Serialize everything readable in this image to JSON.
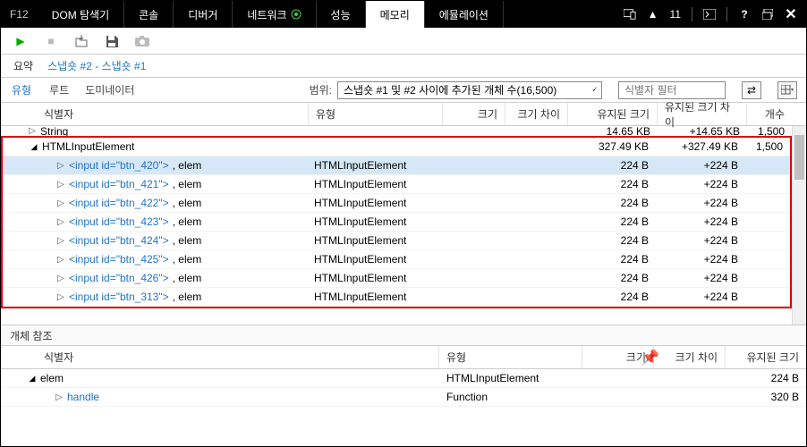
{
  "titlebar": {
    "f12": "F12",
    "tabs": [
      "DOM 탐색기",
      "콘솔",
      "디버거",
      "네트워크",
      "성능",
      "메모리",
      "에뮬레이션"
    ],
    "activeTab": 5,
    "errorCount": "11"
  },
  "subbar": {
    "summary": "요약",
    "link": "스냅숏 #2 - 스냅숏 #1"
  },
  "subbar2": {
    "tabs": [
      "유형",
      "루트",
      "도미네이터"
    ],
    "scopeLabel": "범위:",
    "scopeValue": "스냅숏 #1 및 #2 사이에 추가된 개체 수(16,500)",
    "filterPlaceholder": "식별자 필터"
  },
  "grid": {
    "columns": [
      "식별자",
      "유형",
      "크기",
      "크기 차이",
      "유지된 크기",
      "유지된 크기 차이",
      "개수"
    ],
    "rows": [
      {
        "level": 0,
        "expand": "right",
        "id": "String",
        "type": "",
        "size": "",
        "sdiff": "",
        "ret": "14.65 KB",
        "rdiff": "+14.65 KB",
        "cnt": "1,500",
        "cut": true
      },
      {
        "level": 0,
        "expand": "open",
        "id": "HTMLInputElement",
        "type": "",
        "size": "",
        "sdiff": "",
        "ret": "327.49 KB",
        "rdiff": "+327.49 KB",
        "cnt": "1,500",
        "boxstart": true
      },
      {
        "level": 1,
        "expand": "right",
        "id": "<input id=\"btn_420\">, elem",
        "type": "HTMLInputElement",
        "size": "",
        "sdiff": "",
        "ret": "224 B",
        "rdiff": "+224 B",
        "cnt": "",
        "selected": true,
        "link": true
      },
      {
        "level": 1,
        "expand": "right",
        "id": "<input id=\"btn_421\">, elem",
        "type": "HTMLInputElement",
        "size": "",
        "sdiff": "",
        "ret": "224 B",
        "rdiff": "+224 B",
        "cnt": "",
        "link": true
      },
      {
        "level": 1,
        "expand": "right",
        "id": "<input id=\"btn_422\">, elem",
        "type": "HTMLInputElement",
        "size": "",
        "sdiff": "",
        "ret": "224 B",
        "rdiff": "+224 B",
        "cnt": "",
        "link": true
      },
      {
        "level": 1,
        "expand": "right",
        "id": "<input id=\"btn_423\">, elem",
        "type": "HTMLInputElement",
        "size": "",
        "sdiff": "",
        "ret": "224 B",
        "rdiff": "+224 B",
        "cnt": "",
        "link": true
      },
      {
        "level": 1,
        "expand": "right",
        "id": "<input id=\"btn_424\">, elem",
        "type": "HTMLInputElement",
        "size": "",
        "sdiff": "",
        "ret": "224 B",
        "rdiff": "+224 B",
        "cnt": "",
        "link": true
      },
      {
        "level": 1,
        "expand": "right",
        "id": "<input id=\"btn_425\">, elem",
        "type": "HTMLInputElement",
        "size": "",
        "sdiff": "",
        "ret": "224 B",
        "rdiff": "+224 B",
        "cnt": "",
        "link": true
      },
      {
        "level": 1,
        "expand": "right",
        "id": "<input id=\"btn_426\">, elem",
        "type": "HTMLInputElement",
        "size": "",
        "sdiff": "",
        "ret": "224 B",
        "rdiff": "+224 B",
        "cnt": "",
        "link": true
      },
      {
        "level": 1,
        "expand": "right",
        "id": "<input id=\"btn_313\">, elem",
        "type": "HTMLInputElement",
        "size": "",
        "sdiff": "",
        "ret": "224 B",
        "rdiff": "+224 B",
        "cnt": "",
        "boxend": true,
        "link": true
      }
    ]
  },
  "refs": {
    "title": "개체 참조",
    "columns": [
      "식별자",
      "유형",
      "크기",
      "크기 차이",
      "유지된 크기"
    ],
    "rows": [
      {
        "level": 0,
        "expand": "open",
        "id": "elem",
        "type": "HTMLInputElement",
        "size": "",
        "sdiff": "",
        "ret": "224 B"
      },
      {
        "level": 1,
        "expand": "right",
        "id": "handle",
        "type": "Function",
        "size": "",
        "sdiff": "",
        "ret": "320 B",
        "link": true
      }
    ]
  }
}
